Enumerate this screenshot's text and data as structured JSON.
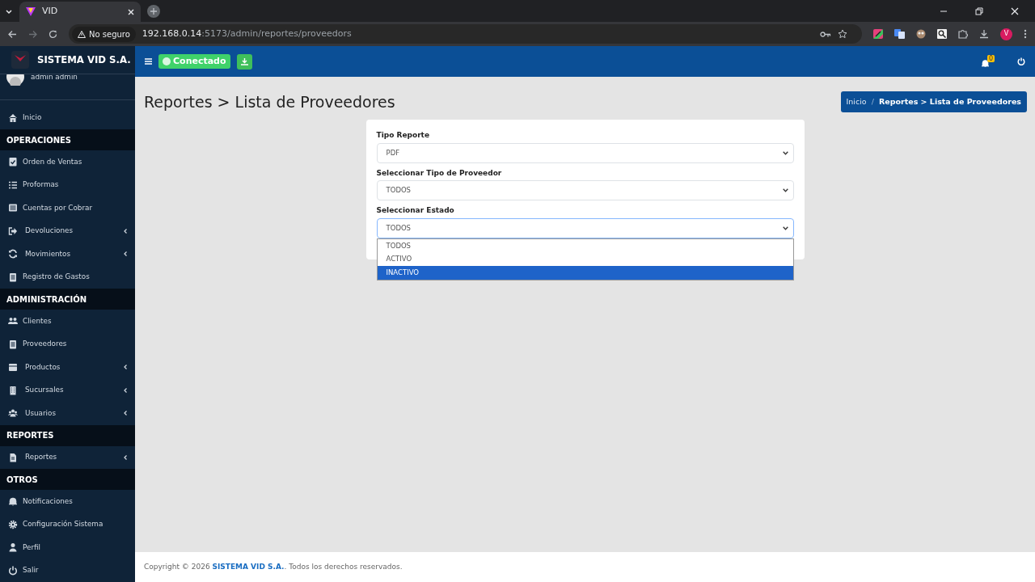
{
  "browser": {
    "tab_title": "VID",
    "security": "No seguro",
    "url_host": "192.168.0.14",
    "url_rest": ":5173/admin/reportes/proveedors",
    "profile_initial": "V"
  },
  "sidebar": {
    "brand": "SISTEMA VID S.A.",
    "user": "admin admin",
    "items": [
      {
        "kind": "link",
        "label": "Inicio",
        "expandable": false
      },
      {
        "kind": "heading",
        "label": "OPERACIONES"
      },
      {
        "kind": "link",
        "label": "Orden de Ventas",
        "expandable": false
      },
      {
        "kind": "link",
        "label": "Proformas",
        "expandable": false
      },
      {
        "kind": "link",
        "label": "Cuentas por Cobrar",
        "expandable": false
      },
      {
        "kind": "link",
        "label": "Devoluciones",
        "expandable": true
      },
      {
        "kind": "link",
        "label": "Movimientos",
        "expandable": true
      },
      {
        "kind": "link",
        "label": "Registro de Gastos",
        "expandable": false
      },
      {
        "kind": "heading",
        "label": "ADMINISTRACIÓN"
      },
      {
        "kind": "link",
        "label": "Clientes",
        "expandable": false
      },
      {
        "kind": "link",
        "label": "Proveedores",
        "expandable": false
      },
      {
        "kind": "link",
        "label": "Productos",
        "expandable": true
      },
      {
        "kind": "link",
        "label": "Sucursales",
        "expandable": true
      },
      {
        "kind": "link",
        "label": "Usuarios",
        "expandable": true
      },
      {
        "kind": "heading",
        "label": "REPORTES"
      },
      {
        "kind": "link",
        "label": "Reportes",
        "expandable": true
      },
      {
        "kind": "heading",
        "label": "OTROS"
      },
      {
        "kind": "link",
        "label": "Notificaciones",
        "expandable": false
      },
      {
        "kind": "link",
        "label": "Configuración Sistema",
        "expandable": false
      },
      {
        "kind": "link",
        "label": "Perfil",
        "expandable": false
      },
      {
        "kind": "link",
        "label": "Salir",
        "expandable": false
      }
    ]
  },
  "topbar": {
    "status": "Conectado",
    "notification_count": "0"
  },
  "page": {
    "title": "Reportes > Lista de Proveedores",
    "breadcrumb_separator": "/",
    "breadcrumb": [
      {
        "label": "Inicio",
        "current": false
      },
      {
        "label": "Reportes > Lista de Proveedores",
        "current": true
      }
    ]
  },
  "form": {
    "fields": [
      {
        "label": "Tipo Reporte",
        "value": "PDF",
        "open": false
      },
      {
        "label": "Seleccionar Tipo de Proveedor",
        "value": "TODOS",
        "open": false
      },
      {
        "label": "Seleccionar Estado",
        "value": "TODOS",
        "open": true,
        "options": [
          {
            "label": "TODOS",
            "highlighted": false
          },
          {
            "label": "ACTIVO",
            "highlighted": false
          },
          {
            "label": "INACTIVO",
            "highlighted": true
          }
        ]
      }
    ]
  },
  "footer": "Copyright © 2026 **SISTEMA VID S.A.**. Todos los derechos reservados."
}
